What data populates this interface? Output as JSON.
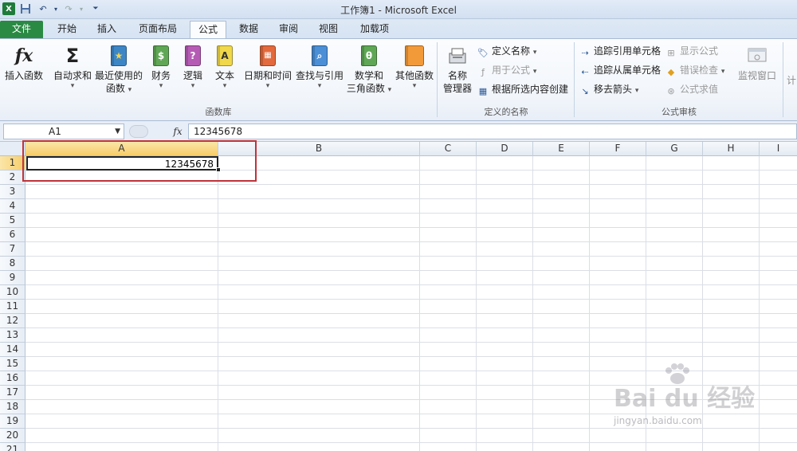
{
  "window": {
    "title": "工作簿1 - Microsoft Excel"
  },
  "tabs": [
    {
      "label": "文件"
    },
    {
      "label": "开始"
    },
    {
      "label": "插入"
    },
    {
      "label": "页面布局"
    },
    {
      "label": "公式"
    },
    {
      "label": "数据"
    },
    {
      "label": "审阅"
    },
    {
      "label": "视图"
    },
    {
      "label": "加载项"
    }
  ],
  "ribbon": {
    "function_library": {
      "group_label": "函数库",
      "insert_function": "插入函数",
      "autosum": "自动求和",
      "recently_used_line1": "最近使用的",
      "recently_used_line2": "函数",
      "financial": "财务",
      "logical": "逻辑",
      "text": "文本",
      "datetime": "日期和时间",
      "lookup": "查找与引用",
      "math_line1": "数学和",
      "math_line2": "三角函数",
      "more": "其他函数"
    },
    "defined_names": {
      "group_label": "定义的名称",
      "name_manager_line1": "名称",
      "name_manager_line2": "管理器",
      "define_name": "定义名称",
      "use_in_formula": "用于公式",
      "create_from_selection": "根据所选内容创建"
    },
    "formula_auditing": {
      "group_label": "公式审核",
      "trace_precedents": "追踪引用单元格",
      "trace_dependents": "追踪从属单元格",
      "remove_arrows": "移去箭头",
      "show_formulas": "显示公式",
      "error_checking": "错误检查",
      "evaluate_formula": "公式求值",
      "watch_window": "监视窗口",
      "calc_partial": "计"
    }
  },
  "formula_bar": {
    "name_box": "A1",
    "fx": "fx",
    "content": "12345678"
  },
  "sheet": {
    "columns": [
      "A",
      "B",
      "C",
      "D",
      "E",
      "F",
      "G",
      "H",
      "I"
    ],
    "rows": [
      "1",
      "2",
      "3",
      "4",
      "5",
      "6",
      "7",
      "8",
      "9",
      "10",
      "11",
      "12",
      "13",
      "14",
      "15",
      "16",
      "17",
      "18",
      "19",
      "20",
      "21"
    ],
    "selected_cell": "A1",
    "cells": {
      "A1": "12345678"
    }
  },
  "watermark": {
    "text": "Bai du 经验",
    "sub": "jingyan.baidu.com"
  },
  "colors": {
    "file_tab": "#2a8a43",
    "highlight": "#c0333a",
    "selected_header": "#f6cd6a"
  },
  "icons": [
    "excel-app-icon",
    "save-icon",
    "undo-icon",
    "redo-icon",
    "customize-qat-icon",
    "fx-icon",
    "sigma-icon",
    "book-icon"
  ]
}
